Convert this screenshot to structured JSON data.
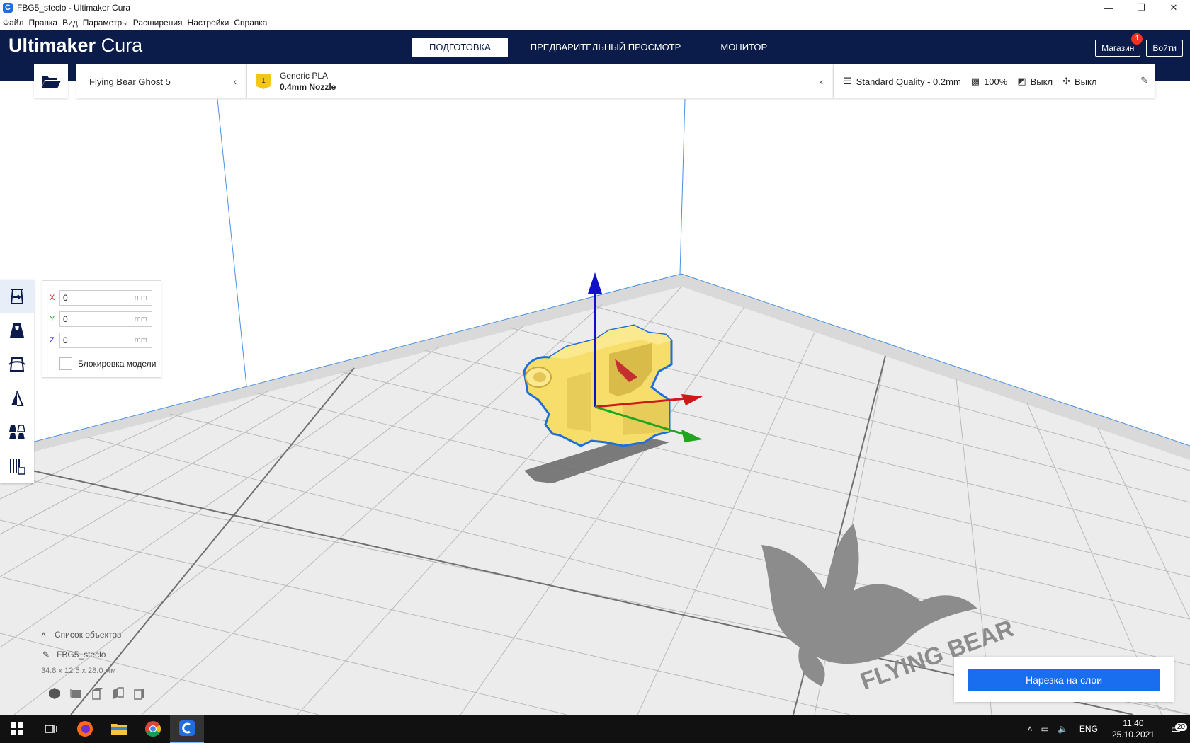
{
  "window": {
    "title": "FBG5_steclo - Ultimaker Cura",
    "minimize": "—",
    "maximize": "❐",
    "close": "✕"
  },
  "menu": [
    "Файл",
    "Правка",
    "Вид",
    "Параметры",
    "Расширения",
    "Настройки",
    "Справка"
  ],
  "header": {
    "brand": "Ultimaker",
    "product": "Cura",
    "tabs": [
      "ПОДГОТОВКА",
      "ПРЕДВАРИТЕЛЬНЫЙ ПРОСМОТР",
      "МОНИТОР"
    ],
    "active_tab": 0,
    "marketplace": "Магазин",
    "marketplace_badge": "1",
    "signin": "Войти"
  },
  "printer": {
    "name": "Flying Bear Ghost 5"
  },
  "material": {
    "extruder_index": "1",
    "name": "Generic PLA",
    "nozzle": "0.4mm Nozzle"
  },
  "print_setup": {
    "profile": "Standard Quality - 0.2mm",
    "infill": "100%",
    "support": "Выкл",
    "adhesion": "Выкл"
  },
  "move_panel": {
    "x_label": "X",
    "y_label": "Y",
    "z_label": "Z",
    "x_value": "0",
    "y_value": "0",
    "z_value": "0",
    "unit": "mm",
    "lock_label": "Блокировка модели",
    "lock_checked": false
  },
  "object_list": {
    "header": "Список объектов",
    "item": "FBG5_steclo",
    "dimensions": "34.8 x 12.5 x 28.0 мм"
  },
  "slice": {
    "button_label": "Нарезка на слои"
  },
  "taskbar": {
    "lang": "ENG",
    "time": "11:40",
    "date": "25.10.2021",
    "notifications": "20"
  },
  "colors": {
    "header_bg": "#0c1c4a",
    "accent": "#196ef0",
    "model": "#f7de6a",
    "axis_x": "#d01818",
    "axis_y": "#1fa51f",
    "axis_z": "#1010c8"
  }
}
